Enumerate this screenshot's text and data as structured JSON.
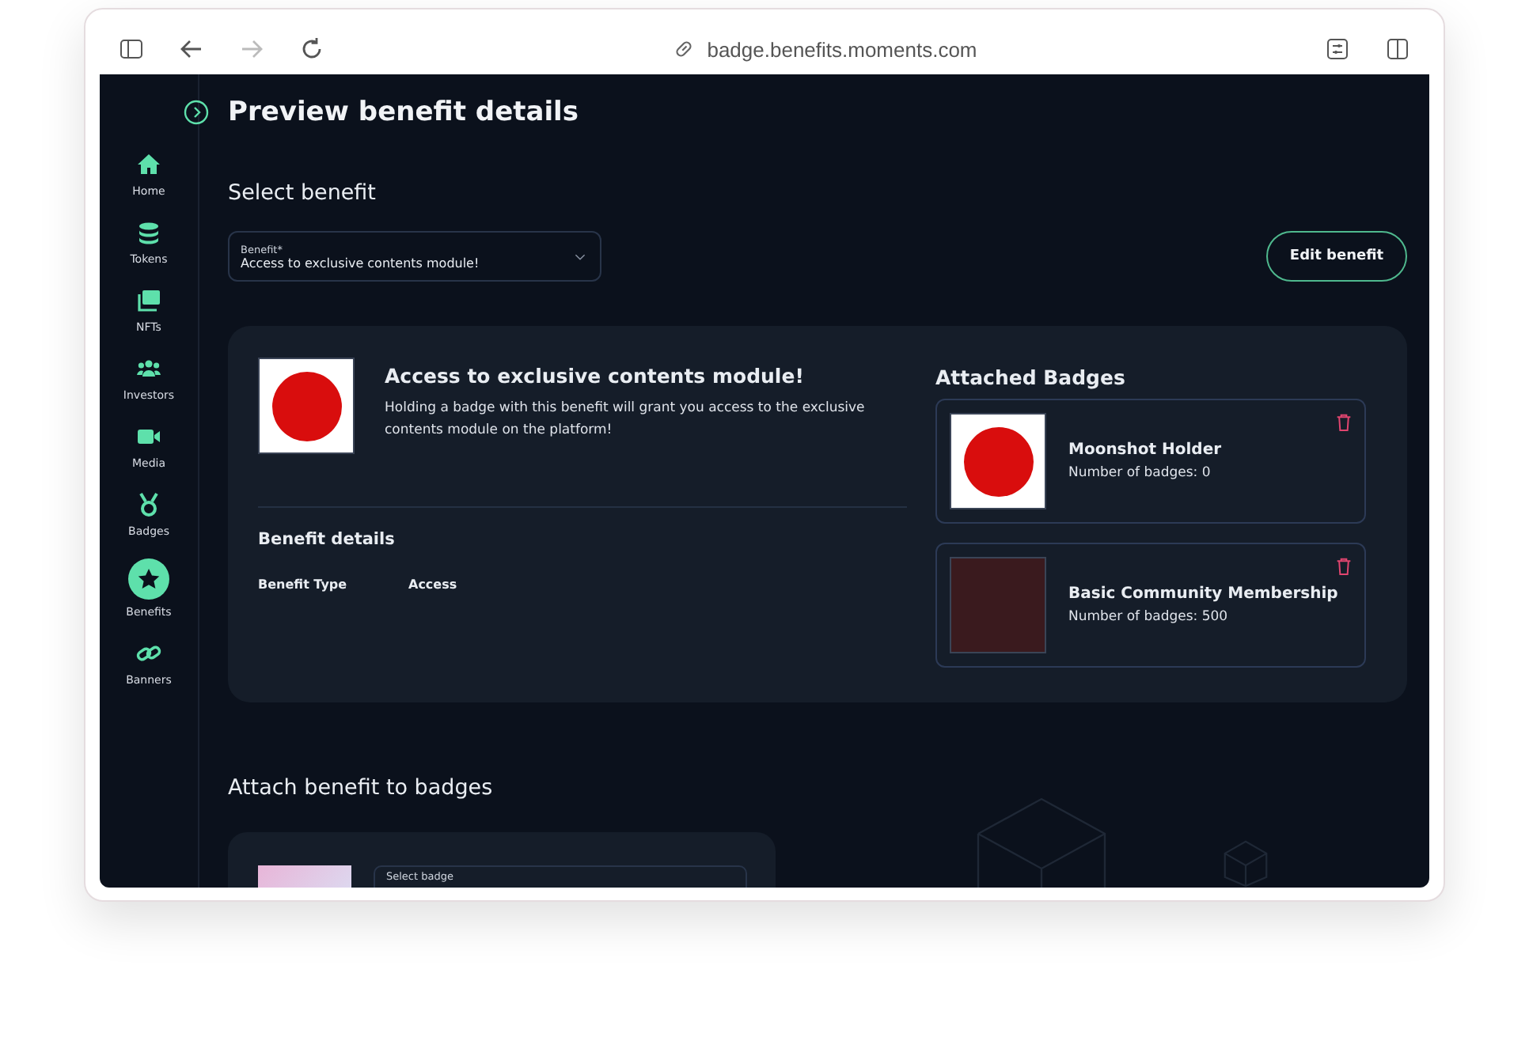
{
  "browser": {
    "url": "badge.benefits.moments.com"
  },
  "sidebar": {
    "items": [
      {
        "label": "Home",
        "kind": "home",
        "selected": false
      },
      {
        "label": "Tokens",
        "kind": "coins",
        "selected": false
      },
      {
        "label": "NFTs",
        "kind": "images",
        "selected": false
      },
      {
        "label": "Investors",
        "kind": "people",
        "selected": false
      },
      {
        "label": "Media",
        "kind": "video",
        "selected": false
      },
      {
        "label": "Badges",
        "kind": "medal",
        "selected": false
      },
      {
        "label": "Benefits",
        "kind": "star",
        "selected": true
      },
      {
        "label": "Banners",
        "kind": "link",
        "selected": false
      }
    ]
  },
  "page_title": "Preview benefit details",
  "select_section": {
    "heading": "Select benefit",
    "field_label": "Benefit*",
    "value": "Access to exclusive contents module!",
    "button": "Edit benefit"
  },
  "benefit": {
    "title": "Access to exclusive contents module!",
    "description": "Holding a badge with this benefit will grant you access to the exclusive contents module on the platform!",
    "details_heading": "Benefit details",
    "details": [
      {
        "label": "Benefit Type",
        "value": "Access"
      }
    ]
  },
  "attached": {
    "heading": "Attached Badges",
    "badges": [
      {
        "name": "Moonshot Holder",
        "count": "Number of badges: 0",
        "kind": "artwork"
      },
      {
        "name": "Basic Community Membership",
        "count": "Number of badges: 500",
        "kind": "photo"
      }
    ]
  },
  "attach_section": {
    "heading": "Attach benefit to badges",
    "field_label": "Select badge"
  }
}
